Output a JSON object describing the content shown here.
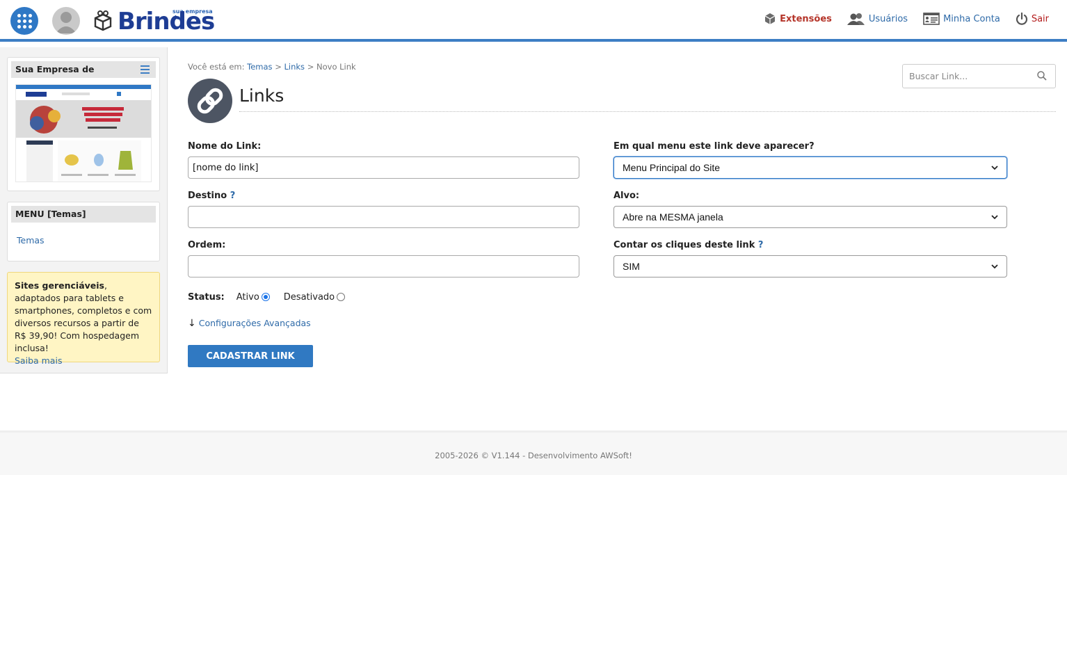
{
  "header": {
    "logo_tagline": "sua empresa de",
    "logo_word": "Brindes",
    "nav": [
      {
        "label": "Extensões",
        "icon": "cube-icon"
      },
      {
        "label": "Usuários",
        "icon": "users-icon"
      },
      {
        "label": "Minha Conta",
        "icon": "account-card-icon"
      },
      {
        "label": "Sair",
        "icon": "power-icon"
      }
    ]
  },
  "sidebar": {
    "site_card_title": "Sua Empresa de",
    "menu_card_title": "MENU [Temas]",
    "menu_items": [
      "Temas"
    ],
    "promo": {
      "bold": "Sites gerenciáveis",
      "text": ", adaptados para tablets e smartphones, completos e com diversos recursos a partir de R$ 39,90! Com hospedagem inclusa!",
      "link": "Saiba mais"
    }
  },
  "breadcrumb": {
    "prefix": "Você está em:",
    "items": [
      "Temas",
      "Links"
    ],
    "current": "Novo Link",
    "sep": ">"
  },
  "search": {
    "placeholder": "Buscar Link..."
  },
  "page": {
    "title": "Links"
  },
  "form": {
    "name_label": "Nome do Link:",
    "name_value": "[nome do link]",
    "dest_label": "Destino",
    "help_mark": "?",
    "dest_value": "",
    "order_label": "Ordem:",
    "order_value": "",
    "menu_label": "Em qual menu este link deve aparecer?",
    "menu_value": "Menu Principal do Site",
    "target_label": "Alvo:",
    "target_value": "Abre na MESMA janela",
    "count_label": "Contar os cliques deste link",
    "count_value": "SIM",
    "status_label": "Status:",
    "status_active": "Ativo",
    "status_inactive": "Desativado",
    "advanced_arrow": "↓",
    "advanced_label": "Configurações Avançadas",
    "submit_label": "CADASTRAR LINK"
  },
  "footer": {
    "text": "2005-2026 © V1.144 - Desenvolvimento AWSoft!"
  },
  "colors": {
    "accent": "#3079c2",
    "header_rule": "#3d7ec4",
    "exit": "#b31b1b",
    "extensions": "#b5352a"
  }
}
